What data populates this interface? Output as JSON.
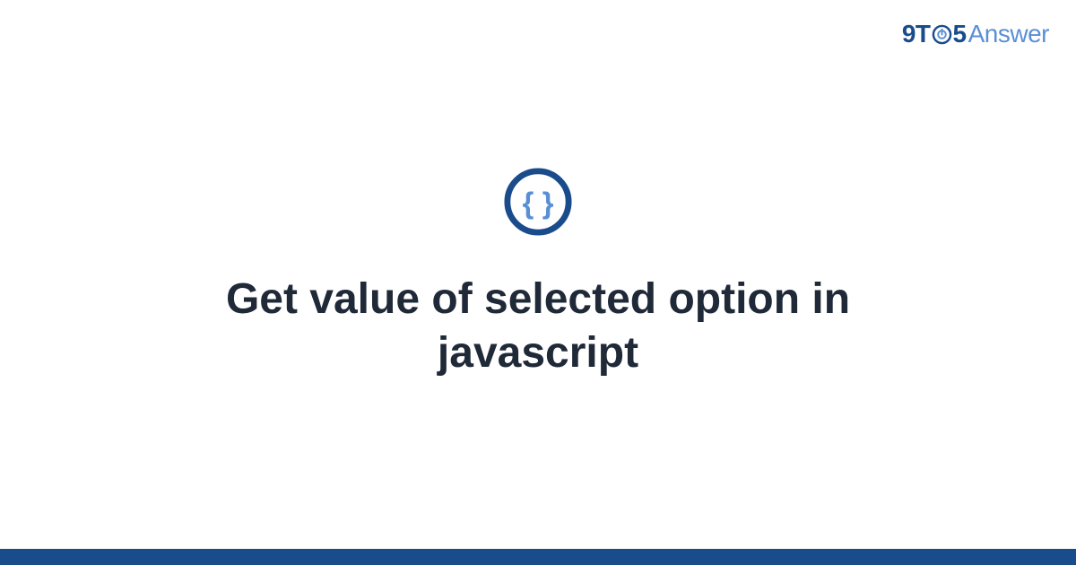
{
  "brand": {
    "prefix": "9T",
    "middle": "5",
    "suffix": "Answer"
  },
  "icon": {
    "name": "code-braces-icon"
  },
  "main": {
    "title": "Get value of selected option in javascript"
  },
  "colors": {
    "brand_dark": "#1a4c8c",
    "brand_light": "#5a8fd6",
    "text": "#1f2937"
  }
}
